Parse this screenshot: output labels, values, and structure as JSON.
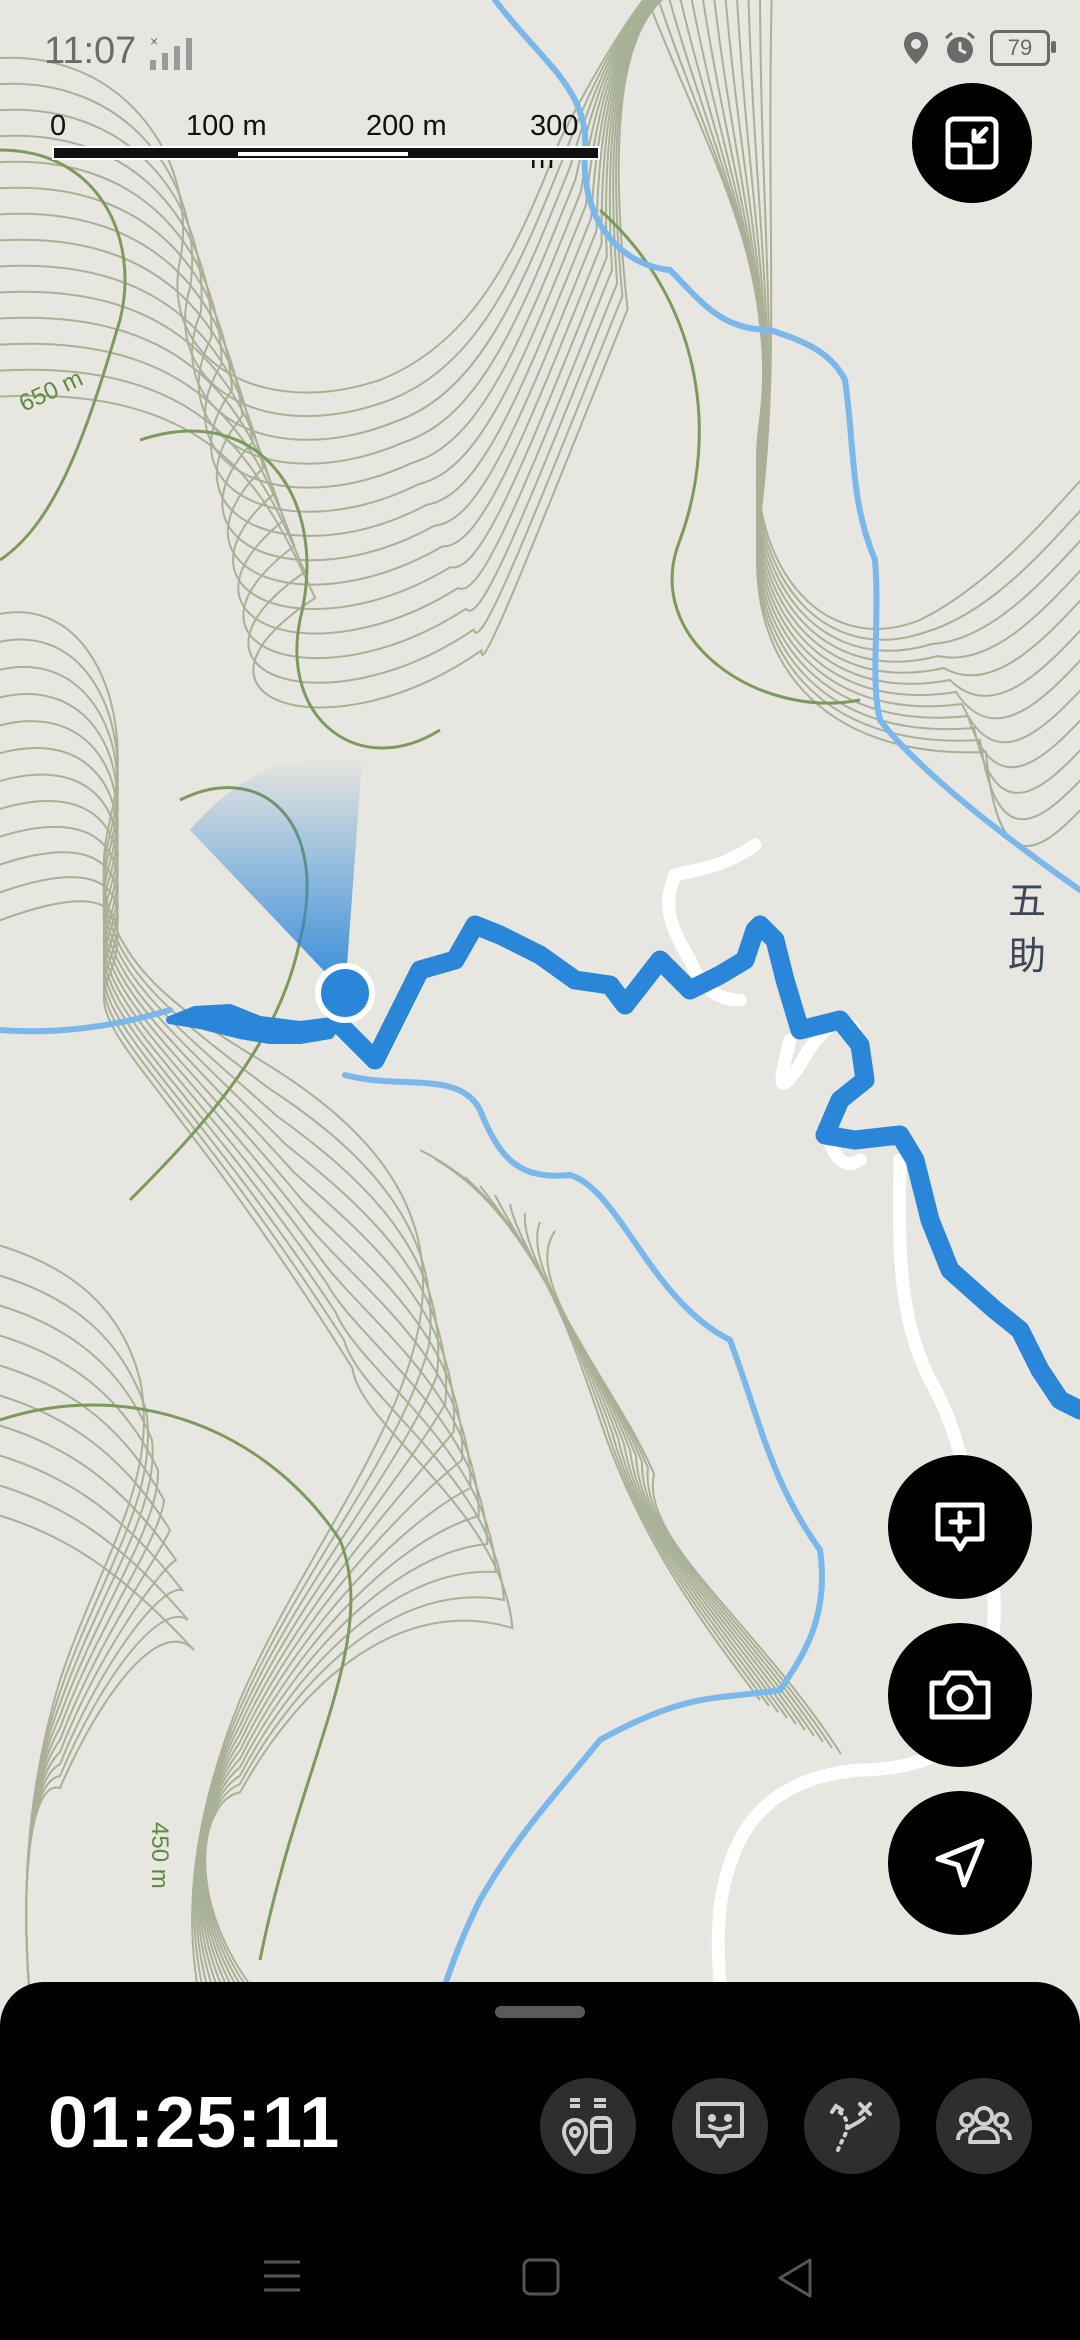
{
  "status_bar": {
    "time": "11:07",
    "battery": "79"
  },
  "scale_bar": {
    "labels": [
      "0",
      "100 m",
      "200 m",
      "300 m"
    ]
  },
  "map": {
    "contour_labels": [
      "650 m",
      "450 m"
    ],
    "place_label": "五助",
    "colors": {
      "track": "#2a86d9",
      "stream": "#7ab8ec",
      "contour_major": "#7b9a5c",
      "contour_minor": "#a8b096",
      "background": "#e8e6e0"
    }
  },
  "fabs": {
    "expand": "expand-icon",
    "add_note": "add-note-icon",
    "camera": "camera-icon",
    "navigate": "navigation-arrow-icon"
  },
  "recording": {
    "elapsed": "01:25:11",
    "actions": [
      "waypoint-bottles-icon",
      "memo-icon",
      "route-icon",
      "group-icon"
    ]
  },
  "system_nav": [
    "menu-icon",
    "home-icon",
    "back-icon"
  ]
}
